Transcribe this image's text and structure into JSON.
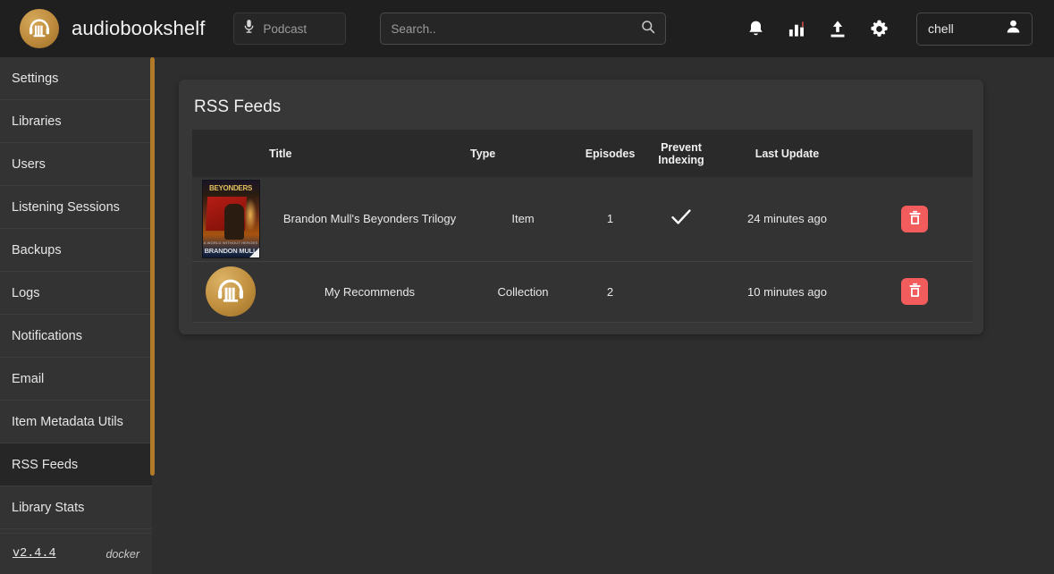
{
  "header": {
    "brand": "audiobookshelf",
    "logo_icon": "audiobookshelf-logo-icon",
    "library_selector": {
      "label": "Podcast",
      "icon": "microphone-icon"
    },
    "search": {
      "placeholder": "Search..",
      "value": "",
      "icon": "search-icon"
    },
    "icons": [
      {
        "name": "bell-icon",
        "label": "Notifications"
      },
      {
        "name": "chart-bar-icon",
        "label": "Stats"
      },
      {
        "name": "upload-icon",
        "label": "Upload"
      },
      {
        "name": "gear-icon",
        "label": "Settings"
      }
    ],
    "user": {
      "name": "chell",
      "icon": "person-icon"
    }
  },
  "sidebar": {
    "items": [
      {
        "label": "Settings",
        "active": false
      },
      {
        "label": "Libraries",
        "active": false
      },
      {
        "label": "Users",
        "active": false
      },
      {
        "label": "Listening Sessions",
        "active": false
      },
      {
        "label": "Backups",
        "active": false
      },
      {
        "label": "Logs",
        "active": false
      },
      {
        "label": "Notifications",
        "active": false
      },
      {
        "label": "Email",
        "active": false
      },
      {
        "label": "Item Metadata Utils",
        "active": false
      },
      {
        "label": "RSS Feeds",
        "active": true
      },
      {
        "label": "Library Stats",
        "active": false
      }
    ],
    "footer": {
      "version": "v2.4.4",
      "environment": "docker"
    }
  },
  "main": {
    "card_title": "RSS Feeds",
    "table": {
      "columns": [
        "",
        "Title",
        "Type",
        "Episodes",
        "Prevent Indexing",
        "Last Update",
        ""
      ],
      "column_prevent_indexing_line1": "Prevent",
      "column_prevent_indexing_line2": "Indexing",
      "rows": [
        {
          "cover_type": "book-cover",
          "cover_title_text": "BEYONDERS",
          "cover_author_text": "BRANDON MULL",
          "cover_sub_text": "A WORLD WITHOUT HEROES",
          "title": "Brandon Mull's Beyonders Trilogy",
          "type": "Item",
          "episodes": "1",
          "prevent_indexing": true,
          "prevent_indexing_icon": "check-icon",
          "last_update": "24 minutes ago",
          "action_icon": "trash-icon"
        },
        {
          "cover_type": "logo-circle",
          "cover_title_text": "",
          "cover_author_text": "",
          "cover_sub_text": "",
          "title": "My Recommends",
          "type": "Collection",
          "episodes": "2",
          "prevent_indexing": false,
          "prevent_indexing_icon": "",
          "last_update": "10 minutes ago",
          "action_icon": "trash-icon"
        }
      ]
    }
  },
  "colors": {
    "accent": "#b07a28",
    "brand_gold": "#c08f3e",
    "danger": "#f25c5c",
    "topbar_bg": "#1f1f1f",
    "sidebar_bg": "#333333",
    "page_bg": "#2e2e2e",
    "card_bg": "#373737",
    "thead_bg": "#2a2a2a"
  }
}
